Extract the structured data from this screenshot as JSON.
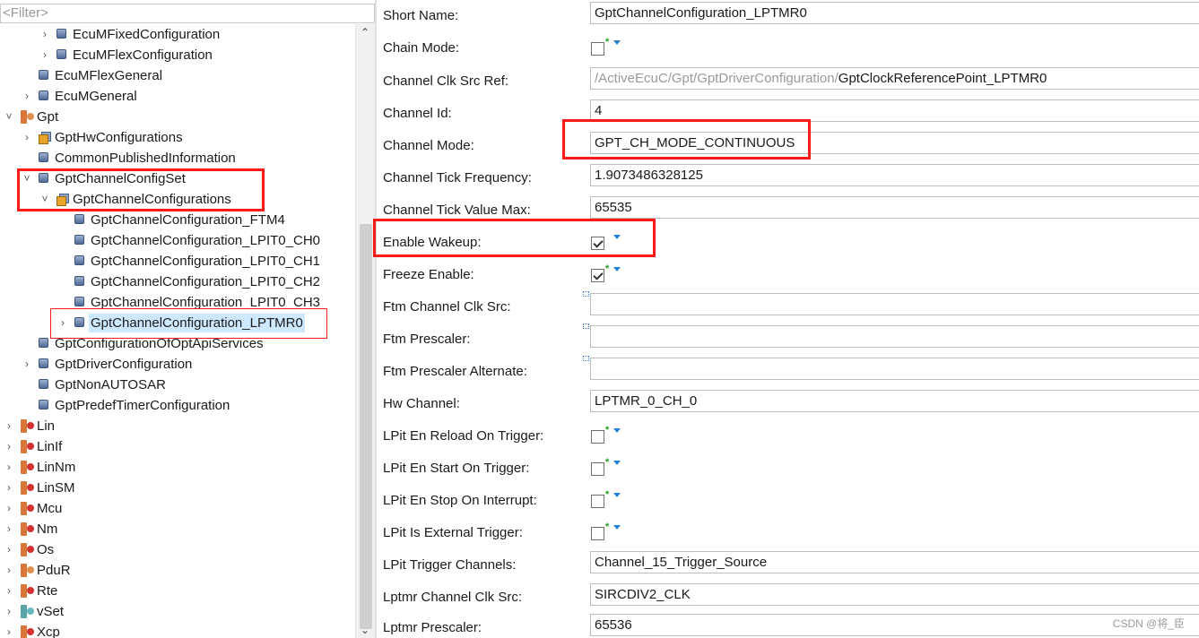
{
  "filter": {
    "placeholder": "<Filter>"
  },
  "tree": {
    "items": [
      {
        "label": "EcuMFixedConfiguration",
        "icon": "param-container-icon",
        "toggle": "collapsed"
      },
      {
        "label": "EcuMFlexConfiguration",
        "icon": "param-container-icon",
        "toggle": "collapsed"
      },
      {
        "label": "EcuMFlexGeneral",
        "icon": "param-container-icon",
        "toggle": "none"
      },
      {
        "label": "EcuMGeneral",
        "icon": "param-container-icon",
        "toggle": "collapsed"
      },
      {
        "label": "Gpt",
        "icon": "module-icon",
        "toggle": "expanded"
      },
      {
        "label": "GptHwConfigurations",
        "icon": "multi-container-icon",
        "toggle": "collapsed"
      },
      {
        "label": "CommonPublishedInformation",
        "icon": "param-container-icon",
        "toggle": "none"
      },
      {
        "label": "GptChannelConfigSet",
        "icon": "param-container-icon",
        "toggle": "expanded"
      },
      {
        "label": "GptChannelConfigurations",
        "icon": "multi-container-icon",
        "toggle": "expanded"
      },
      {
        "label": "GptChannelConfiguration_FTM4",
        "icon": "param-container-icon",
        "toggle": "none"
      },
      {
        "label": "GptChannelConfiguration_LPIT0_CH0",
        "icon": "param-container-icon",
        "toggle": "none"
      },
      {
        "label": "GptChannelConfiguration_LPIT0_CH1",
        "icon": "param-container-icon",
        "toggle": "none"
      },
      {
        "label": "GptChannelConfiguration_LPIT0_CH2",
        "icon": "param-container-icon",
        "toggle": "none"
      },
      {
        "label": "GptChannelConfiguration_LPIT0_CH3",
        "icon": "param-container-icon",
        "toggle": "none"
      },
      {
        "label": "GptChannelConfiguration_LPTMR0",
        "icon": "param-container-icon",
        "toggle": "collapsed",
        "selected": true
      },
      {
        "label": "GptConfigurationOfOptApiServices",
        "icon": "param-container-icon",
        "toggle": "none"
      },
      {
        "label": "GptDriverConfiguration",
        "icon": "param-container-icon",
        "toggle": "collapsed"
      },
      {
        "label": "GptNonAUTOSAR",
        "icon": "param-container-icon",
        "toggle": "none"
      },
      {
        "label": "GptPredefTimerConfiguration",
        "icon": "param-container-icon",
        "toggle": "none"
      },
      {
        "label": "Lin",
        "icon": "module-icon",
        "toggle": "collapsed"
      },
      {
        "label": "LinIf",
        "icon": "module-icon",
        "toggle": "collapsed"
      },
      {
        "label": "LinNm",
        "icon": "module-icon",
        "toggle": "collapsed"
      },
      {
        "label": "LinSM",
        "icon": "module-icon",
        "toggle": "collapsed"
      },
      {
        "label": "Mcu",
        "icon": "module-icon",
        "toggle": "collapsed"
      },
      {
        "label": "Nm",
        "icon": "module-icon",
        "toggle": "collapsed"
      },
      {
        "label": "Os",
        "icon": "module-icon",
        "toggle": "collapsed"
      },
      {
        "label": "PduR",
        "icon": "module-icon",
        "toggle": "collapsed"
      },
      {
        "label": "Rte",
        "icon": "module-icon",
        "toggle": "collapsed"
      },
      {
        "label": "vSet",
        "icon": "module-icon",
        "toggle": "collapsed"
      },
      {
        "label": "Xcp",
        "icon": "module-icon",
        "toggle": "collapsed"
      }
    ]
  },
  "properties": {
    "short_name": {
      "label": "Short Name:",
      "value": "GptChannelConfiguration_LPTMR0"
    },
    "chain_mode": {
      "label": "Chain Mode:",
      "checked": false
    },
    "clk_src_ref": {
      "label": "Channel Clk Src Ref:",
      "path_grey": "/ActiveEcuC/Gpt/GptDriverConfiguration/",
      "path_value": "GptClockReferencePoint_LPTMR0"
    },
    "channel_id": {
      "label": "Channel Id:",
      "value": "4"
    },
    "channel_mode": {
      "label": "Channel Mode:",
      "value": "GPT_CH_MODE_CONTINUOUS"
    },
    "tick_freq": {
      "label": "Channel Tick Frequency:",
      "value": "1.9073486328125"
    },
    "tick_max": {
      "label": "Channel Tick Value Max:",
      "value": "65535"
    },
    "enable_wakeup": {
      "label": "Enable Wakeup:",
      "checked": true
    },
    "freeze_enable": {
      "label": "Freeze Enable:",
      "checked": true
    },
    "ftm_clk_src": {
      "label": "Ftm Channel Clk Src:",
      "value": ""
    },
    "ftm_prescaler": {
      "label": "Ftm Prescaler:",
      "value": ""
    },
    "ftm_prescaler_alt": {
      "label": "Ftm Prescaler  Alternate:",
      "value": ""
    },
    "hw_channel": {
      "label": "Hw Channel:",
      "value": "LPTMR_0_CH_0"
    },
    "lpit_reload": {
      "label": "LPit En Reload On Trigger:",
      "checked": false
    },
    "lpit_start": {
      "label": "LPit En Start On Trigger:",
      "checked": false
    },
    "lpit_stop": {
      "label": "LPit En Stop On Interrupt:",
      "checked": false
    },
    "lpit_ext": {
      "label": "LPit Is External Trigger:",
      "checked": false
    },
    "lpit_trigger_channels": {
      "label": "LPit Trigger Channels:",
      "value": "Channel_15_Trigger_Source"
    },
    "lptmr_clk_src": {
      "label": "Lptmr Channel Clk Src:",
      "value": "SIRCDIV2_CLK"
    },
    "lptmr_prescaler": {
      "label": "Lptmr Prescaler:",
      "value": "65536"
    }
  },
  "watermark": "CSDN @将_臣",
  "colors": {
    "highlight": "#ff1a1a",
    "selection": "#cde8ff",
    "star": "#21a021",
    "caret": "#1f7fd1"
  }
}
